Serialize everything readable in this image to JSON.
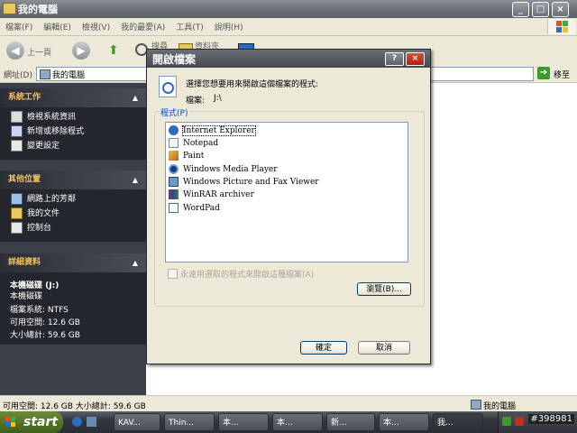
{
  "window": {
    "title": "我的電腦",
    "controls": [
      "_",
      "□",
      "×"
    ]
  },
  "menu": [
    "檔案(F)",
    "編輯(E)",
    "檢視(V)",
    "我的最愛(A)",
    "工具(T)",
    "說明(H)"
  ],
  "toolbar": {
    "back_label": "上一頁",
    "search_label": "搜尋",
    "folders_label": "資料夾"
  },
  "address": {
    "label": "網址(D)",
    "value": "我的電腦",
    "go_label": "移至"
  },
  "left_pane": {
    "system_tasks": {
      "title": "系統工作",
      "items": [
        "檢視系統資訊",
        "新增或移除程式",
        "變更設定"
      ]
    },
    "other_places": {
      "title": "其他位置",
      "items": [
        "網路上的芳鄰",
        "我的文件",
        "控制台"
      ]
    },
    "details": {
      "title": "詳細資料",
      "name": "本機磁碟 (J:)",
      "type": "本機磁碟",
      "filesystem": "檔案系統: NTFS",
      "free": "可用空間: 12.6 GB",
      "total": "大小總計: 59.6 GB"
    }
  },
  "statusbar": {
    "left": "可用空間: 12.6 GB 大小總計: 59.6 GB",
    "right": "我的電腦"
  },
  "dialog": {
    "title": "開啟檔案",
    "help_label": "?",
    "close_label": "×",
    "prompt": "選擇您想要用來開啟這個檔案的程式:",
    "file_label": "檔案:",
    "file_value": "J:\\",
    "group_label": "程式(P)",
    "programs": [
      {
        "name": "Internet Explorer",
        "icon": "ie-icon",
        "selected": true
      },
      {
        "name": "Notepad",
        "icon": "notepad-icon"
      },
      {
        "name": "Paint",
        "icon": "paint-icon"
      },
      {
        "name": "Windows Media Player",
        "icon": "media-player-icon"
      },
      {
        "name": "Windows Picture and Fax Viewer",
        "icon": "picture-viewer-icon"
      },
      {
        "name": "WinRAR archiver",
        "icon": "winrar-icon"
      },
      {
        "name": "WordPad",
        "icon": "wordpad-icon"
      }
    ],
    "always_use_label": "永遠用選取的程式來開啟這種檔案(A)",
    "always_use_checked": false,
    "browse_label": "瀏覽(B)...",
    "ok_label": "確定",
    "cancel_label": "取消"
  },
  "taskbar": {
    "start_label": "start",
    "buttons": [
      "KAV...",
      "Thin...",
      "本...",
      "本...",
      "新...",
      "本...",
      "我..."
    ],
    "clock": "#398981"
  }
}
